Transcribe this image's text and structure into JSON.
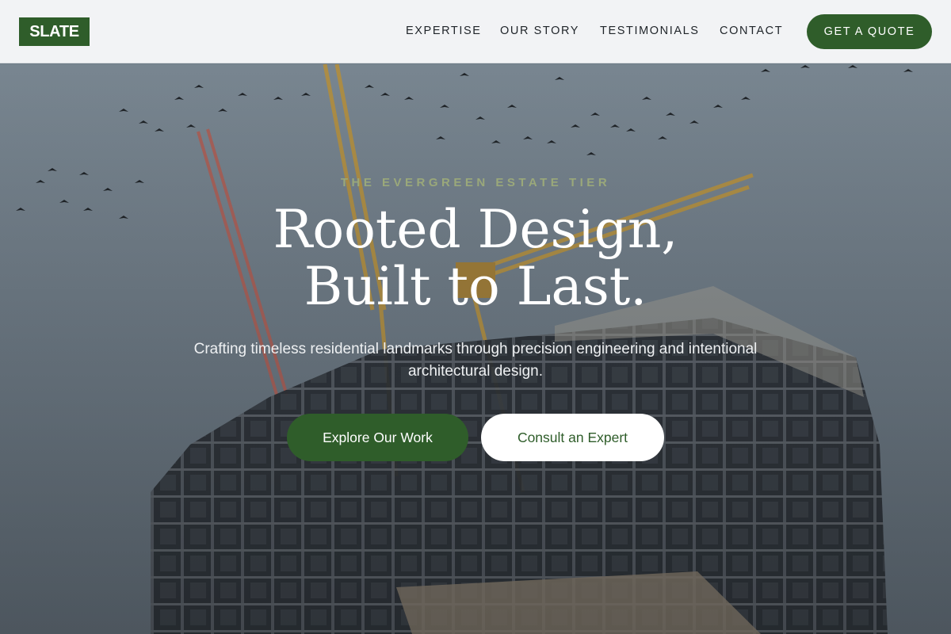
{
  "header": {
    "logo": "SLATE",
    "nav": [
      {
        "label": "EXPERTISE"
      },
      {
        "label": "OUR STORY"
      },
      {
        "label": "TESTIMONIALS"
      },
      {
        "label": "CONTACT"
      }
    ],
    "cta_label": "GET A QUOTE"
  },
  "hero": {
    "eyebrow": "THE EVERGREEN ESTATE TIER",
    "headline_line1": "Rooted Design,",
    "headline_line2": "Built to Last.",
    "subtitle": "Crafting timeless residential landmarks through precision engineering and intentional architectural design.",
    "primary_label": "Explore Our Work",
    "secondary_label": "Consult an Expert"
  },
  "colors": {
    "brand_green": "#2f5d2a",
    "header_bg": "#f2f3f5",
    "eyebrow": "#9aa87a"
  }
}
